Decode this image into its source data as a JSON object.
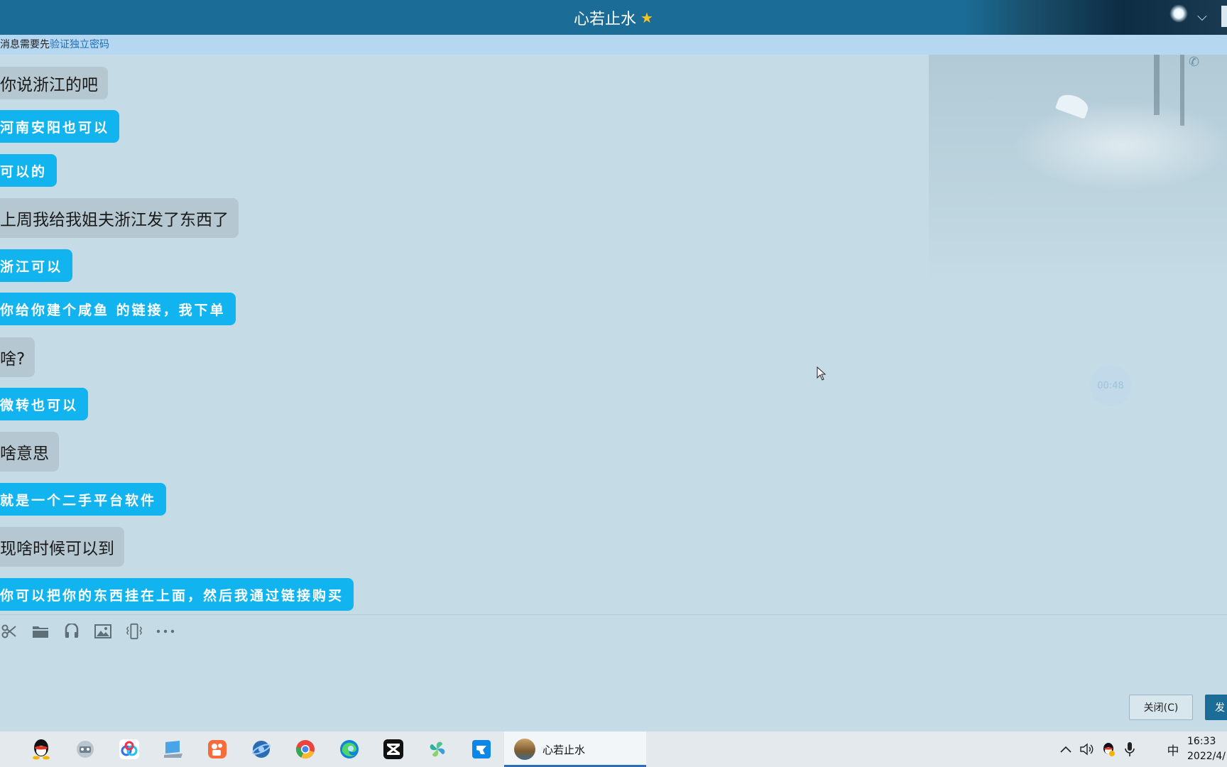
{
  "window": {
    "title": "心若止水",
    "title_star_icon": "star-icon",
    "collapse_icon": "chevron-down-icon"
  },
  "notice": {
    "text": "消息需要先",
    "link": "验证独立密码"
  },
  "messages": [
    {
      "style": "gray",
      "text": "你说浙江的吧"
    },
    {
      "style": "blue",
      "text": "河南安阳也可以"
    },
    {
      "style": "blue",
      "text": "可以的"
    },
    {
      "style": "gray",
      "text": "上周我给我姐夫浙江发了东西了"
    },
    {
      "style": "blue",
      "text": "浙江可以"
    },
    {
      "style": "blue",
      "text": "你给你建个咸鱼 的链接，我下单"
    },
    {
      "style": "gray",
      "text": "啥?"
    },
    {
      "style": "blue",
      "text": "微转也可以"
    },
    {
      "style": "gray",
      "text": "啥意思"
    },
    {
      "style": "blue",
      "text": "就是一个二手平台软件"
    },
    {
      "style": "gray",
      "text": "现啥时候可以到"
    },
    {
      "style": "blue",
      "text": "你可以把你的东西挂在上面，然后我通过链接购买"
    }
  ],
  "call_timer": "00:48",
  "toolbar": {
    "icons": [
      "scissors-icon",
      "folder-icon",
      "music-icon",
      "image-icon",
      "vibrate-icon",
      "more-icon"
    ]
  },
  "buttons": {
    "close": "关闭(C)",
    "send": "发"
  },
  "taskbar": {
    "apps": [
      "qq-icon",
      "mail-robot-icon",
      "baidu-netdisk-icon",
      "this-pc-icon",
      "kuaishou-icon",
      "browser-globe-icon",
      "chrome-icon",
      "edge-icon",
      "capcut-icon",
      "pinwheel-icon",
      "feishu-icon"
    ],
    "active_window_label": "心若止水",
    "tray": {
      "input_method": "中",
      "time": "16:33",
      "date": "2022/4/"
    }
  }
}
